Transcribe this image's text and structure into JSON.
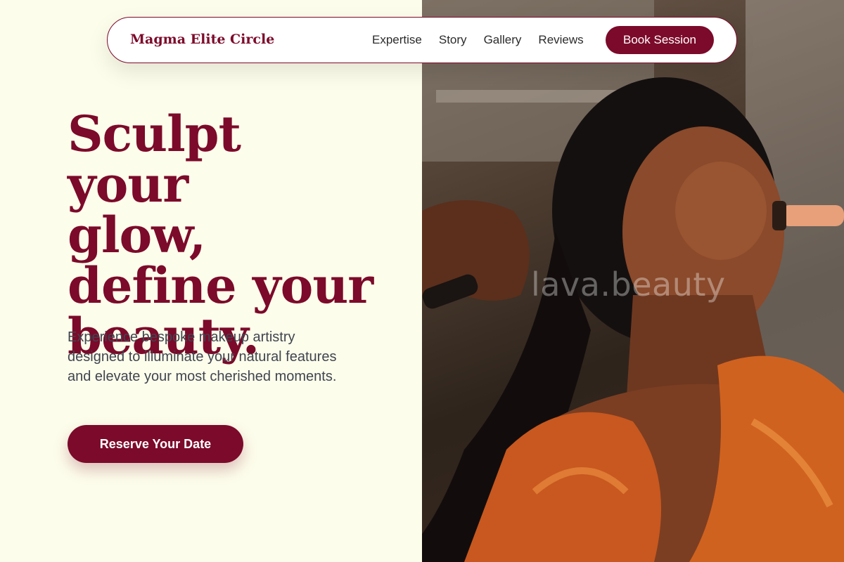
{
  "brand": {
    "name": "Magma Elite Circle"
  },
  "nav": {
    "links": [
      "Expertise",
      "Story",
      "Gallery",
      "Reviews"
    ],
    "cta_label": "Book Session"
  },
  "hero": {
    "headline_lines": [
      "Sculpt your",
      "glow,",
      "define your",
      "beauty."
    ],
    "subtext": "Experience bespoke makeup artistry designed to illuminate your natural features and elevate your most cherished moments.",
    "cta_label": "Reserve Your Date",
    "image_watermark": "lava.beauty"
  },
  "colors": {
    "accent": "#7c0a2a",
    "background": "#fdfdeb",
    "body_text": "#3f4550"
  }
}
